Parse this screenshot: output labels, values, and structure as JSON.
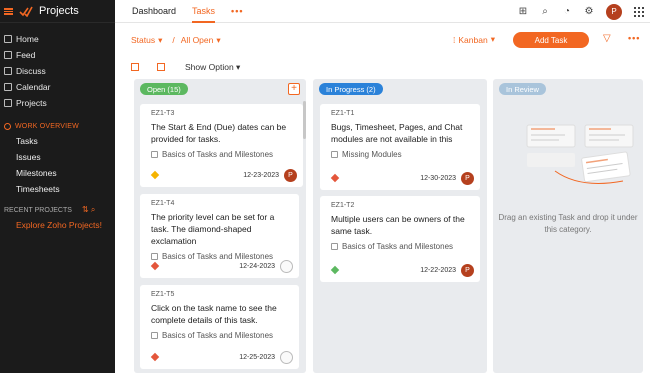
{
  "app": {
    "name": "Projects"
  },
  "sidebar": {
    "items": [
      {
        "label": "Home",
        "icon": "home-icon"
      },
      {
        "label": "Feed",
        "icon": "feed-icon"
      },
      {
        "label": "Discuss",
        "icon": "discuss-icon"
      },
      {
        "label": "Calendar",
        "icon": "calendar-icon"
      },
      {
        "label": "Projects",
        "icon": "projects-icon"
      }
    ],
    "work_overview_title": "WORK OVERVIEW",
    "work_overview": [
      "Tasks",
      "Issues",
      "Milestones",
      "Timesheets"
    ],
    "recent_title": "RECENT PROJECTS",
    "explore": "Explore Zoho Projects!"
  },
  "topbar": {
    "tabs": [
      "Dashboard",
      "Tasks"
    ],
    "more": "•••",
    "avatar": "P"
  },
  "filters": {
    "status": "Status",
    "sep": "/",
    "view": "All Open",
    "layout": "Kanban",
    "add_task": "Add Task",
    "more": "•••"
  },
  "subbar": {
    "show_option": "Show Option"
  },
  "columns": {
    "open": {
      "label": "Open (15)",
      "cards": [
        {
          "id": "EZ1-T3",
          "title": "The Start & End (Due) dates can be provided for tasks.",
          "milestone": "Basics of Tasks and Milestones",
          "date": "12-23-2023",
          "avatar": "P",
          "priority_color": "#f5b400"
        },
        {
          "id": "EZ1-T4",
          "title": "The priority level can be set for a task. The diamond-shaped exclamation",
          "milestone": "Basics of Tasks and Milestones",
          "date": "12-24-2023",
          "avatar": "",
          "priority_color": "#e4563b"
        },
        {
          "id": "EZ1-T5",
          "title": "Click on the task name to see the complete details of this task.",
          "milestone": "Basics of Tasks and Milestones",
          "date": "12-25-2023",
          "avatar": "",
          "priority_color": "#e4563b"
        }
      ]
    },
    "progress": {
      "label": "In Progress (2)",
      "cards": [
        {
          "id": "EZ1-T1",
          "title": "Bugs, Timesheet, Pages, and Chat modules are not available in this",
          "milestone": "Missing Modules",
          "date": "12-30-2023",
          "avatar": "P",
          "priority_color": "#e4563b"
        },
        {
          "id": "EZ1-T2",
          "title": "Multiple users can be owners of the same task.",
          "milestone": "Basics of Tasks and Milestones",
          "date": "12-22-2023",
          "avatar": "P",
          "priority_color": "#5cb860"
        }
      ]
    },
    "review": {
      "label": "In Review",
      "empty_text": "Drag an existing Task and drop it under this category."
    }
  },
  "colors": {
    "accent": "#f26722",
    "sidebar_bg": "#1b1b1b",
    "open": "#5cb860",
    "progress": "#2b82d9",
    "review": "#a9c4db"
  }
}
